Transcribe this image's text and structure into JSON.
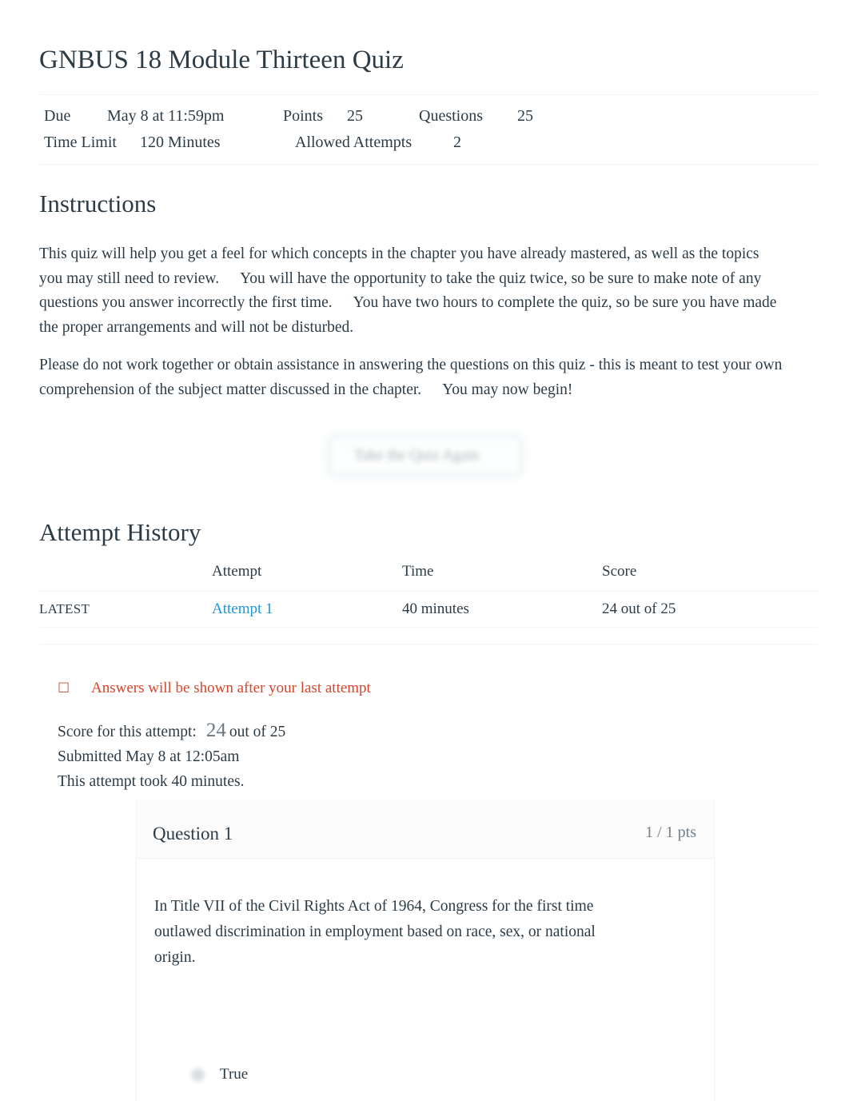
{
  "quiz": {
    "title": "GNBUS 18 Module Thirteen Quiz",
    "details": {
      "due_label": "Due",
      "due_value": "May 8 at 11:59pm",
      "points_label": "Points",
      "points_value": "25",
      "questions_label": "Questions",
      "questions_value": "25",
      "time_limit_label": "Time Limit",
      "time_limit_value": "120 Minutes",
      "allowed_attempts_label": "Allowed Attempts",
      "allowed_attempts_value": "2"
    }
  },
  "instructions": {
    "heading": "Instructions",
    "paragraph1_a": "This quiz will help you get a feel for which concepts in the chapter you have already mastered, as well as the topics you may still need to review.",
    "paragraph1_b": "You will have the opportunity to take the quiz twice, so be sure to make note of any questions you answer incorrectly the first time.",
    "paragraph1_c": "You have two hours to complete the quiz, so be sure you have made the proper arrangements and will not be disturbed.",
    "paragraph2_a": "Please do not work together or obtain assistance in answering the questions on this quiz - this is meant to test your own comprehension of the subject matter discussed in the chapter.",
    "paragraph2_b": "You may now begin!"
  },
  "retake": {
    "label": "Take the Quiz Again"
  },
  "attempt_history": {
    "heading": "Attempt History",
    "columns": [
      "",
      "Attempt",
      "Time",
      "Score"
    ],
    "rows": [
      {
        "kept": "LATEST",
        "attempt": "Attempt 1",
        "time": "40 minutes",
        "score": "24 out of 25"
      }
    ]
  },
  "notice": {
    "icon": "warning-icon",
    "icon_glyph": "☐",
    "text": "Answers will be shown after your last attempt",
    "color": "#d8452a"
  },
  "attempt_summary": {
    "score_label": "Score for this attempt:",
    "score_value": "24",
    "score_suffix": "out of 25",
    "submitted": "Submitted May 8 at 12:05am",
    "duration": "This attempt took 40 minutes."
  },
  "question": {
    "title": "Question 1",
    "points": "1 / 1 pts",
    "text": "In Title VII of the Civil Rights Act of 1964, Congress for the first time outlawed discrimination in employment based on race, sex, or national origin.",
    "answers": [
      {
        "label": "True"
      }
    ]
  },
  "colors": {
    "link": "#2196d8",
    "warning": "#d8452a",
    "text": "#2d3b45",
    "muted": "#76818a"
  }
}
